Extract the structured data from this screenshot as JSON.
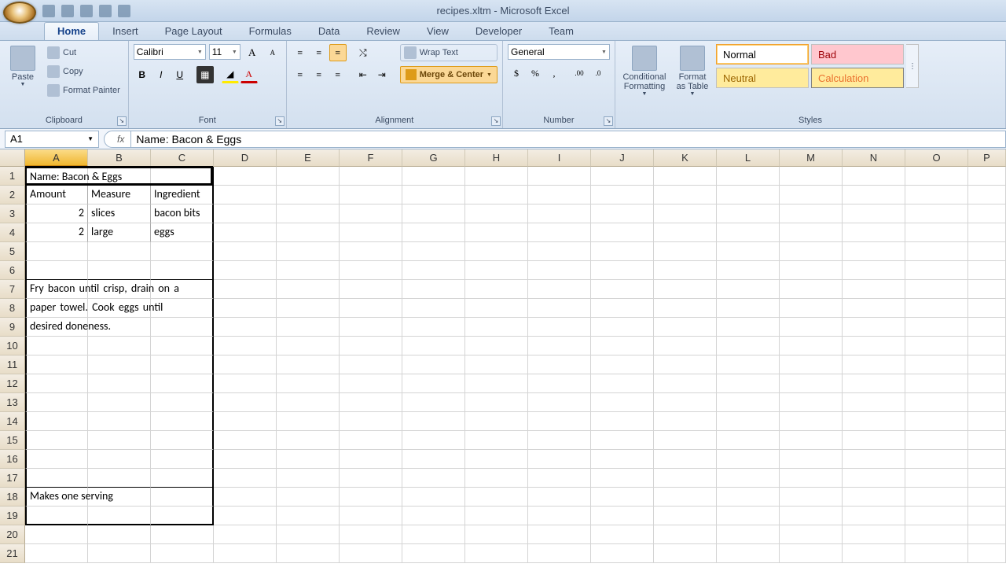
{
  "app": {
    "title": "recipes.xltm - Microsoft Excel"
  },
  "tabs": {
    "home": "Home",
    "insert": "Insert",
    "pagelayout": "Page Layout",
    "formulas": "Formulas",
    "data": "Data",
    "review": "Review",
    "view": "View",
    "developer": "Developer",
    "team": "Team"
  },
  "ribbon": {
    "clipboard": {
      "label": "Clipboard",
      "paste": "Paste",
      "cut": "Cut",
      "copy": "Copy",
      "format_painter": "Format Painter"
    },
    "font": {
      "label": "Font",
      "name": "Calibri",
      "size": "11"
    },
    "alignment": {
      "label": "Alignment",
      "wrap": "Wrap Text",
      "merge": "Merge & Center"
    },
    "number": {
      "label": "Number",
      "format": "General"
    },
    "styles": {
      "label": "Styles",
      "cond": "Conditional Formatting",
      "fat": "Format as Table",
      "normal": "Normal",
      "bad": "Bad",
      "neutral": "Neutral",
      "calc": "Calculation"
    }
  },
  "fbar": {
    "namebox": "A1",
    "formula": "Name: Bacon & Eggs"
  },
  "columns": [
    "A",
    "B",
    "C",
    "D",
    "E",
    "F",
    "G",
    "H",
    "I",
    "J",
    "K",
    "L",
    "M",
    "N",
    "O",
    "P"
  ],
  "rows": [
    "1",
    "2",
    "3",
    "4",
    "5",
    "6",
    "7",
    "8",
    "9",
    "10",
    "11",
    "12",
    "13",
    "14",
    "15",
    "16",
    "17",
    "18",
    "19",
    "20",
    "21"
  ],
  "cells": {
    "A1": "Name: Bacon & Eggs",
    "A2": "Amount",
    "B2": "Measure",
    "C2": "Ingredient",
    "A3": "2",
    "B3": "slices",
    "C3": "bacon bits",
    "A4": "2",
    "B4": "large",
    "C4": "eggs",
    "A7": "Fry bacon until crisp, drain on a",
    "A8": "paper towel. Cook eggs until",
    "A9": "desired doneness.",
    "A18": "Makes one serving"
  }
}
